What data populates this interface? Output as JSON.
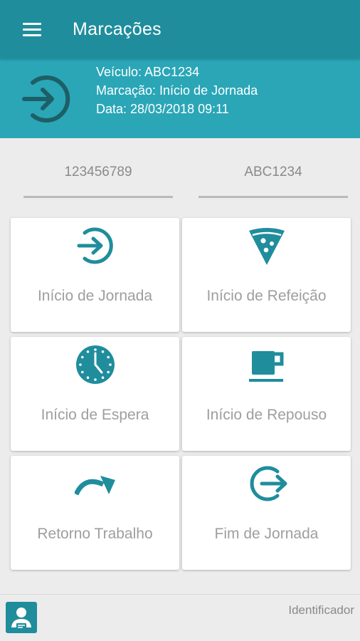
{
  "appbar": {
    "title": "Marcações",
    "menu_icon": "menu-icon"
  },
  "info": {
    "icon": "sign-in-icon",
    "vehicle": "Veículo: ABC1234",
    "marking": "Marcação: Início de Jornada",
    "date": "Data: 28/03/2018 09:11"
  },
  "fields": {
    "left": "123456789",
    "right": "ABC1234"
  },
  "actions": [
    {
      "label": "Início de Jornada",
      "icon": "sign-in-icon"
    },
    {
      "label": "Início de Refeição",
      "icon": "pizza-icon"
    },
    {
      "label": "Início de Espera",
      "icon": "clock-icon"
    },
    {
      "label": "Início de Repouso",
      "icon": "coffee-cup-icon"
    },
    {
      "label": "Retorno Trabalho",
      "icon": "redo-arrow-icon"
    },
    {
      "label": "Fim de Jornada",
      "icon": "sign-out-icon"
    }
  ],
  "footer": {
    "label": "Identificador",
    "avatar_icon": "user-id-icon"
  },
  "colors": {
    "primary_dark": "#1f8d9c",
    "primary": "#2aa6b7",
    "icon_color": "#1f8d9c"
  }
}
